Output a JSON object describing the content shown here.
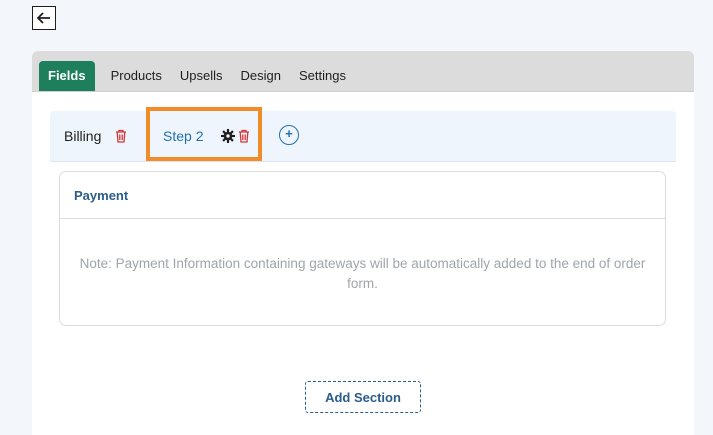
{
  "header": {
    "back_icon": "arrow-left-icon"
  },
  "tabs": [
    {
      "label": "Fields",
      "active": true
    },
    {
      "label": "Products",
      "active": false
    },
    {
      "label": "Upsells",
      "active": false
    },
    {
      "label": "Design",
      "active": false
    },
    {
      "label": "Settings",
      "active": false
    }
  ],
  "steps": [
    {
      "label": "Billing",
      "icons": [
        "trash-icon"
      ]
    },
    {
      "label": "Step 2",
      "icons": [
        "gear-icon",
        "trash-icon"
      ],
      "highlighted": true
    }
  ],
  "add_step_symbol": "+",
  "section": {
    "title": "Payment",
    "note": "Note: Payment Information containing gateways will be automatically added to the end of order form."
  },
  "add_section_label": "Add Section",
  "colors": {
    "accent_green": "#1e7f5c",
    "link_blue": "#2271b1",
    "delete_red": "#d63638",
    "highlight_orange": "#f28c28"
  }
}
